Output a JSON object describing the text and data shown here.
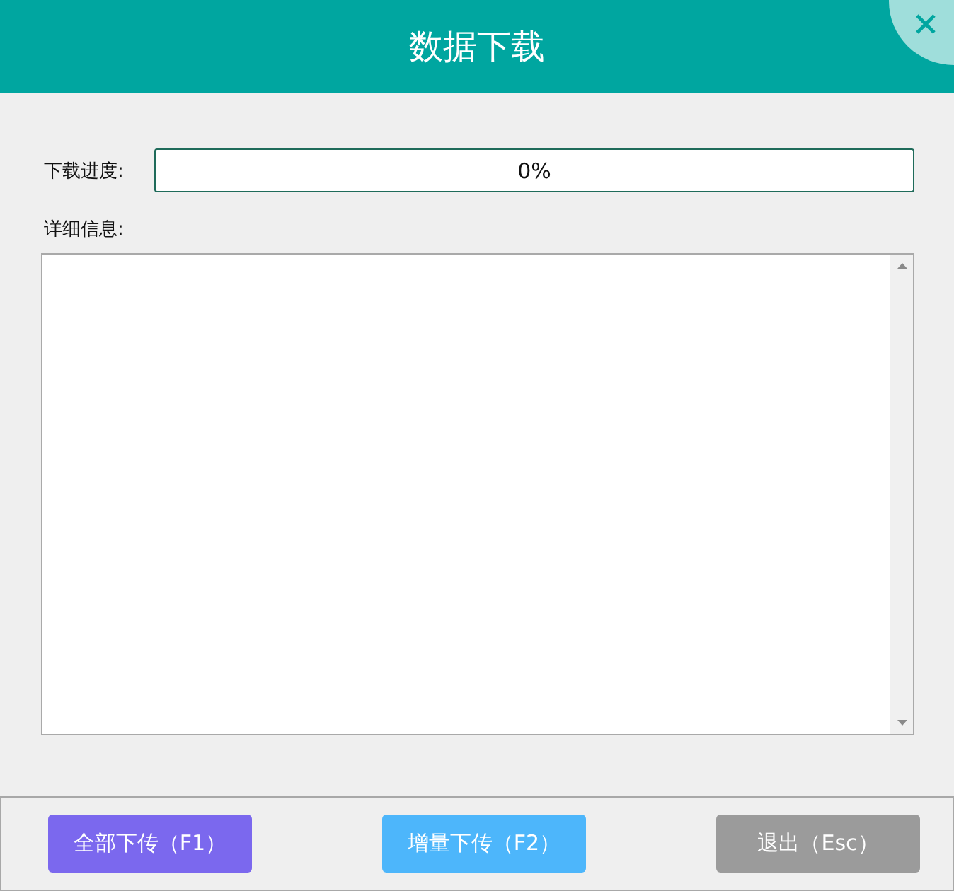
{
  "window": {
    "title": "数据下载"
  },
  "progress": {
    "label": "下载进度:",
    "level": 0,
    "reading": "0%"
  },
  "details": {
    "label": "详细信息:"
  },
  "buttons": [
    {
      "label": "全部下传（F1）",
      "color": "#7b68ee"
    },
    {
      "label": "增量下传（F2）",
      "color": "#4db6fb"
    },
    {
      "label": "退出（Esc）",
      "color": "#9b9b9b"
    }
  ]
}
